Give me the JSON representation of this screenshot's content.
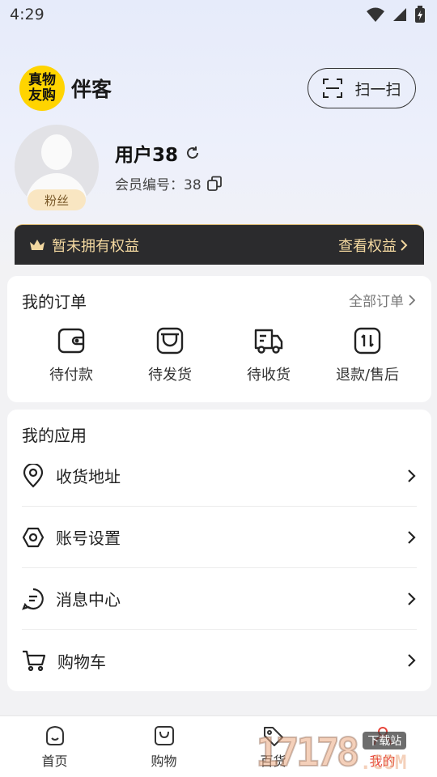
{
  "status_bar": {
    "time": "4:29"
  },
  "header": {
    "logo_line1": "真物",
    "logo_line2": "友购",
    "app_name": "伴客",
    "scan_label": "扫一扫"
  },
  "profile": {
    "badge": "粉丝",
    "user_name": "用户38",
    "member_no": "会员编号：38"
  },
  "vip": {
    "status": "暂未拥有权益",
    "link": "查看权益"
  },
  "orders": {
    "title": "我的订单",
    "all_label": "全部订单",
    "items": [
      {
        "label": "待付款",
        "icon": "wallet-icon"
      },
      {
        "label": "待发货",
        "icon": "package-icon"
      },
      {
        "label": "待收货",
        "icon": "truck-icon"
      },
      {
        "label": "退款/售后",
        "icon": "refund-icon"
      }
    ]
  },
  "apps": {
    "title": "我的应用",
    "items": [
      {
        "label": "收货地址",
        "icon": "location-icon"
      },
      {
        "label": "账号设置",
        "icon": "settings-icon"
      },
      {
        "label": "消息中心",
        "icon": "message-icon"
      },
      {
        "label": "购物车",
        "icon": "cart-icon"
      }
    ]
  },
  "tab_bar": {
    "items": [
      {
        "label": "首页",
        "icon": "home-icon"
      },
      {
        "label": "购物",
        "icon": "shopping-bag-icon"
      },
      {
        "label": "百货",
        "icon": "tag-icon"
      },
      {
        "label": "我的",
        "icon": "user-icon"
      }
    ],
    "active": "我的"
  },
  "watermark": {
    "number": "17178",
    "tag": "下载站",
    "suffix": ".COM"
  }
}
